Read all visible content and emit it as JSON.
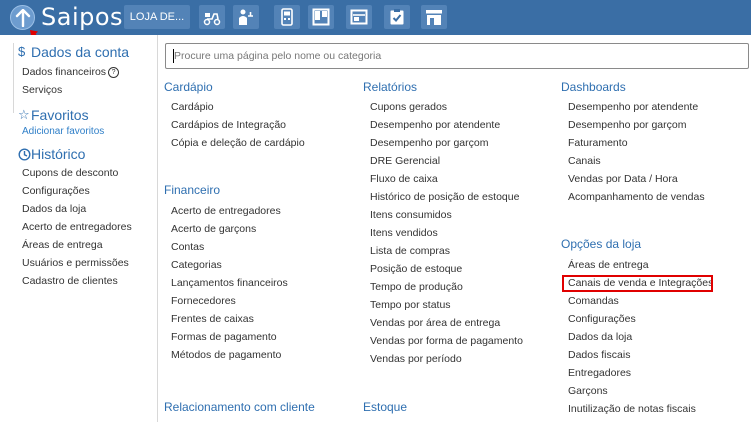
{
  "topbar": {
    "brand": "Saipos",
    "store_button": "LOJA DE...",
    "icons": [
      "delivery-scooter-icon",
      "waiter-icon",
      "card-machine-icon",
      "board-icon",
      "menu-board-icon",
      "clipboard-check-icon",
      "store-icon"
    ]
  },
  "sidebar": {
    "account_title": "Dados da conta",
    "account_items": [
      "Dados financeiros",
      "Serviços"
    ],
    "favorites_title": "Favoritos",
    "add_favorites": "Adicionar favoritos",
    "history_title": "Histórico",
    "history_items": [
      "Cupons de desconto",
      "Configurações",
      "Dados da loja",
      "Acerto de entregadores",
      "Áreas de entrega",
      "Usuários e permissões",
      "Cadastro de clientes"
    ]
  },
  "search": {
    "placeholder": "Procure uma página pelo nome ou categoria"
  },
  "columns": {
    "cardapio": {
      "title": "Cardápio",
      "items": [
        "Cardápio",
        "Cardápios de Integração",
        "Cópia e deleção de cardápio"
      ]
    },
    "financeiro": {
      "title": "Financeiro",
      "items": [
        "Acerto de entregadores",
        "Acerto de garçons",
        "Contas",
        "Categorias",
        "Lançamentos financeiros",
        "Fornecedores",
        "Frentes de caixas",
        "Formas de pagamento",
        "Métodos de pagamento"
      ]
    },
    "relacionamento": {
      "title": "Relacionamento com cliente"
    },
    "relatorios": {
      "title": "Relatórios",
      "items": [
        "Cupons gerados",
        "Desempenho por atendente",
        "Desempenho por garçom",
        "DRE Gerencial",
        "Fluxo de caixa",
        "Histórico de posição de estoque",
        "Itens consumidos",
        "Itens vendidos",
        "Lista de compras",
        "Posição de estoque",
        "Tempo de produção",
        "Tempo por status",
        "Vendas por área de entrega",
        "Vendas por forma de pagamento",
        "Vendas por período"
      ]
    },
    "estoque": {
      "title": "Estoque"
    },
    "dashboards": {
      "title": "Dashboards",
      "items": [
        "Desempenho por atendente",
        "Desempenho por garçom",
        "Faturamento",
        "Canais",
        "Vendas por Data / Hora",
        "Acompanhamento de vendas"
      ]
    },
    "opcoes": {
      "title": "Opções da loja",
      "items": [
        "Áreas de entrega",
        "Canais de venda e Integrações",
        "Comandas",
        "Configurações",
        "Dados da loja",
        "Dados fiscais",
        "Entregadores",
        "Garçons",
        "Inutilização de notas fiscais"
      ]
    }
  }
}
